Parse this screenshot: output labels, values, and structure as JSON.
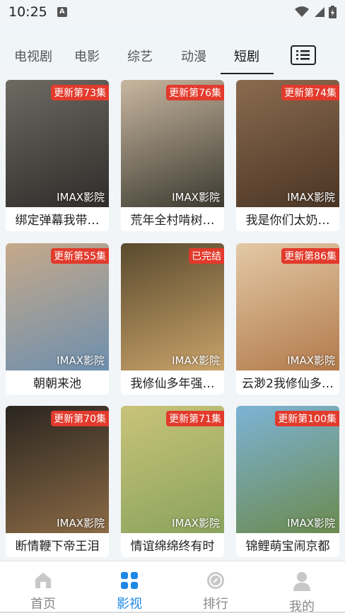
{
  "status_bar": {
    "time": "10:25",
    "notification_letter": "A"
  },
  "tabs": [
    {
      "label": "电视剧"
    },
    {
      "label": "电影"
    },
    {
      "label": "综艺"
    },
    {
      "label": "动漫"
    },
    {
      "label": "短剧"
    }
  ],
  "active_tab": "短剧",
  "list_button_icon": "list-icon",
  "items": [
    {
      "title": "绑定弹幕我带…",
      "badge": "更新第73集",
      "source": "IMAX影院",
      "colors": [
        "#6d6a62",
        "#2f2c2a"
      ]
    },
    {
      "title": "荒年全村啃树…",
      "badge": "更新第76集",
      "source": "IMAX影院",
      "colors": [
        "#c9b7a0",
        "#3b3a30"
      ]
    },
    {
      "title": "我是你们太奶…",
      "badge": "更新第74集",
      "source": "IMAX影院",
      "colors": [
        "#8b6b4f",
        "#4a3525"
      ]
    },
    {
      "title": "朝朝来池",
      "badge": "更新第55集",
      "source": "IMAX影院",
      "colors": [
        "#c6a98a",
        "#6d8fae"
      ]
    },
    {
      "title": "我修仙多年强…",
      "badge": "已完结",
      "source": "IMAX影院",
      "colors": [
        "#5a4a2e",
        "#c9a36a"
      ]
    },
    {
      "title": "云渺2我修仙多…",
      "badge": "更新第86集",
      "source": "IMAX影院",
      "colors": [
        "#e3c9a6",
        "#b27a4b"
      ]
    },
    {
      "title": "断情鞭下帝王泪",
      "badge": "更新第70集",
      "source": "IMAX影院",
      "colors": [
        "#2a2520",
        "#8b6a45"
      ]
    },
    {
      "title": "情谊绵绵终有时",
      "badge": "更新第71集",
      "source": "IMAX影院",
      "colors": [
        "#c9c37a",
        "#8aa35c"
      ]
    },
    {
      "title": "锦鲤萌宝闹京都",
      "badge": "更新第100集",
      "source": "IMAX影院",
      "colors": [
        "#7db3d6",
        "#6b8a4e"
      ]
    }
  ],
  "bottom_nav": [
    {
      "label": "首页",
      "icon": "home-icon"
    },
    {
      "label": "影视",
      "icon": "grid-icon"
    },
    {
      "label": "排行",
      "icon": "compass-icon"
    },
    {
      "label": "我的",
      "icon": "user-icon"
    }
  ],
  "active_nav": "影视",
  "colors": {
    "accent": "#1e88e5",
    "badge": "#e23a2c",
    "background": "#f2f5f7"
  }
}
